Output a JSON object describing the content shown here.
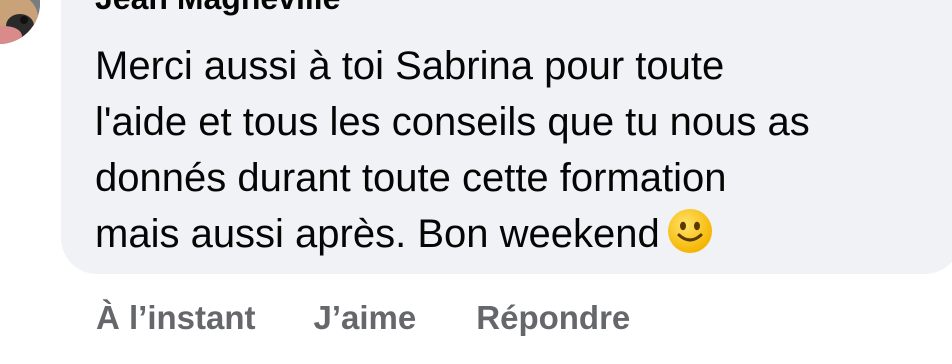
{
  "comment": {
    "author": "Jean Magneville",
    "text": "Merci aussi à toi Sabrina pour toute\nl'aide et tous les conseils que tu nous as\ndonnés durant toute cette formation\nmais aussi après. Bon weekend",
    "emoji": "slightly-smiling-face-emoji"
  },
  "actions": {
    "timestamp": "À l’instant",
    "like_label": "J’aime",
    "reply_label": "Répondre"
  },
  "colors": {
    "bubble_background": "#f0f2f5",
    "text": "#050505",
    "secondary_text": "#65676b"
  }
}
